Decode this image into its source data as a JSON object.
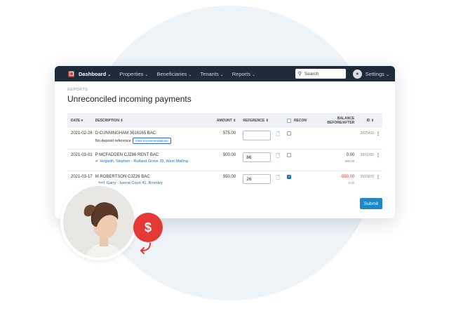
{
  "nav": {
    "items": [
      {
        "label": "Dashboard",
        "active": true
      },
      {
        "label": "Properties",
        "active": false
      },
      {
        "label": "Beneficiaries",
        "active": false
      },
      {
        "label": "Tenants",
        "active": false
      },
      {
        "label": "Reports",
        "active": false
      }
    ],
    "search_placeholder": "Search",
    "settings_label": "Settings"
  },
  "page": {
    "breadcrumb": "REPORTS",
    "title": "Unreconciled incoming payments",
    "submit_label": "Submit"
  },
  "table": {
    "headers": {
      "date": "DATE",
      "description": "DESCRIPTION",
      "amount": "AMOUNT",
      "reference": "REFERENCE",
      "recon": "RECON",
      "balance": "BALANCE BEFORE/AFTER",
      "id": "ID"
    },
    "rows": [
      {
        "date": "2021-02-26",
        "description": "D CUNNINGHAM 3616165 BAC",
        "sub": "No deposit reference",
        "action": "View recommendations",
        "amount": "575.00",
        "reference": "",
        "recon": false,
        "balance_before": "",
        "balance_after": "",
        "id": "2825410"
      },
      {
        "date": "2021-03-01",
        "description": "P MCFADDEN CJZ86 RENT BAC",
        "match": "Hogarth, Stephen - Rutland Grove 39, West Malling",
        "amount": "500.00",
        "reference": "86",
        "recon": false,
        "balance_before": "0.00",
        "balance_after": "500.00",
        "id": "2831265"
      },
      {
        "date": "2021-03-17",
        "description": "M ROBERTSON CJZ26 BAC",
        "match": "...hell, Garry - Iverna Court 41, Bromley",
        "amount": "550.00",
        "reference": "26",
        "recon": true,
        "balance_before": "-550.00",
        "balance_after": "0.00",
        "id": "2916870"
      }
    ]
  },
  "badge": {
    "symbol": "$"
  },
  "colors": {
    "navbar": "#1e2b3a",
    "accent": "#1e88c8",
    "danger": "#e53935"
  }
}
